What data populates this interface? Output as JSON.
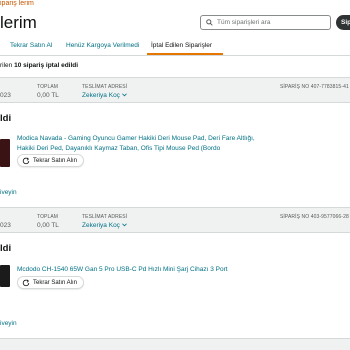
{
  "breadcrumb": "ipariş lerim",
  "page_title": "lerim",
  "search": {
    "placeholder": "Tüm siparişleri ara",
    "button": "Sipa"
  },
  "tabs": [
    {
      "label": "Tekrar Satın Al"
    },
    {
      "label": "Henüz Kargoya Verilmedi"
    },
    {
      "label": "İptal Edilen Siparişler"
    }
  ],
  "summary": {
    "prefix": "rilen",
    "bold": "10 sipariş iptal edildi"
  },
  "orders": [
    {
      "year": "023",
      "total_label": "TOPLAM",
      "total": "0,00 TL",
      "ship_label": "TESLİMAT ADRESİ",
      "ship_to": "Zekeriya Koç",
      "order_label": "SİPARİŞ NO 407-7783815-41",
      "status": "ldi",
      "product": "Modica Navada - Gaming Oyuncu Gamer Hakiki Deri Mouse Pad, Deri Fare Altlığı, Hakiki Deri Ped, Dayanıklı Kaymaz Taban, Ofis Tipi Mouse Ped (Bordo",
      "buy_again": "Tekrar Satın Alın",
      "more": "iveyin"
    },
    {
      "year": "023",
      "total_label": "TOPLAM",
      "total": "0,00 TL",
      "ship_label": "TESLİMAT ADRESİ",
      "ship_to": "Zekeriya Koç",
      "order_label": "SİPARİŞ NO 403-9577066-28",
      "status": "ldi",
      "product": "Mcdodo CH-1540 65W Gan 5 Pro USB-C Pd Hızlı Mini Şarj Cihazı 3 Port",
      "buy_again": "Tekrar Satın Alın",
      "more": "iveyin"
    }
  ]
}
